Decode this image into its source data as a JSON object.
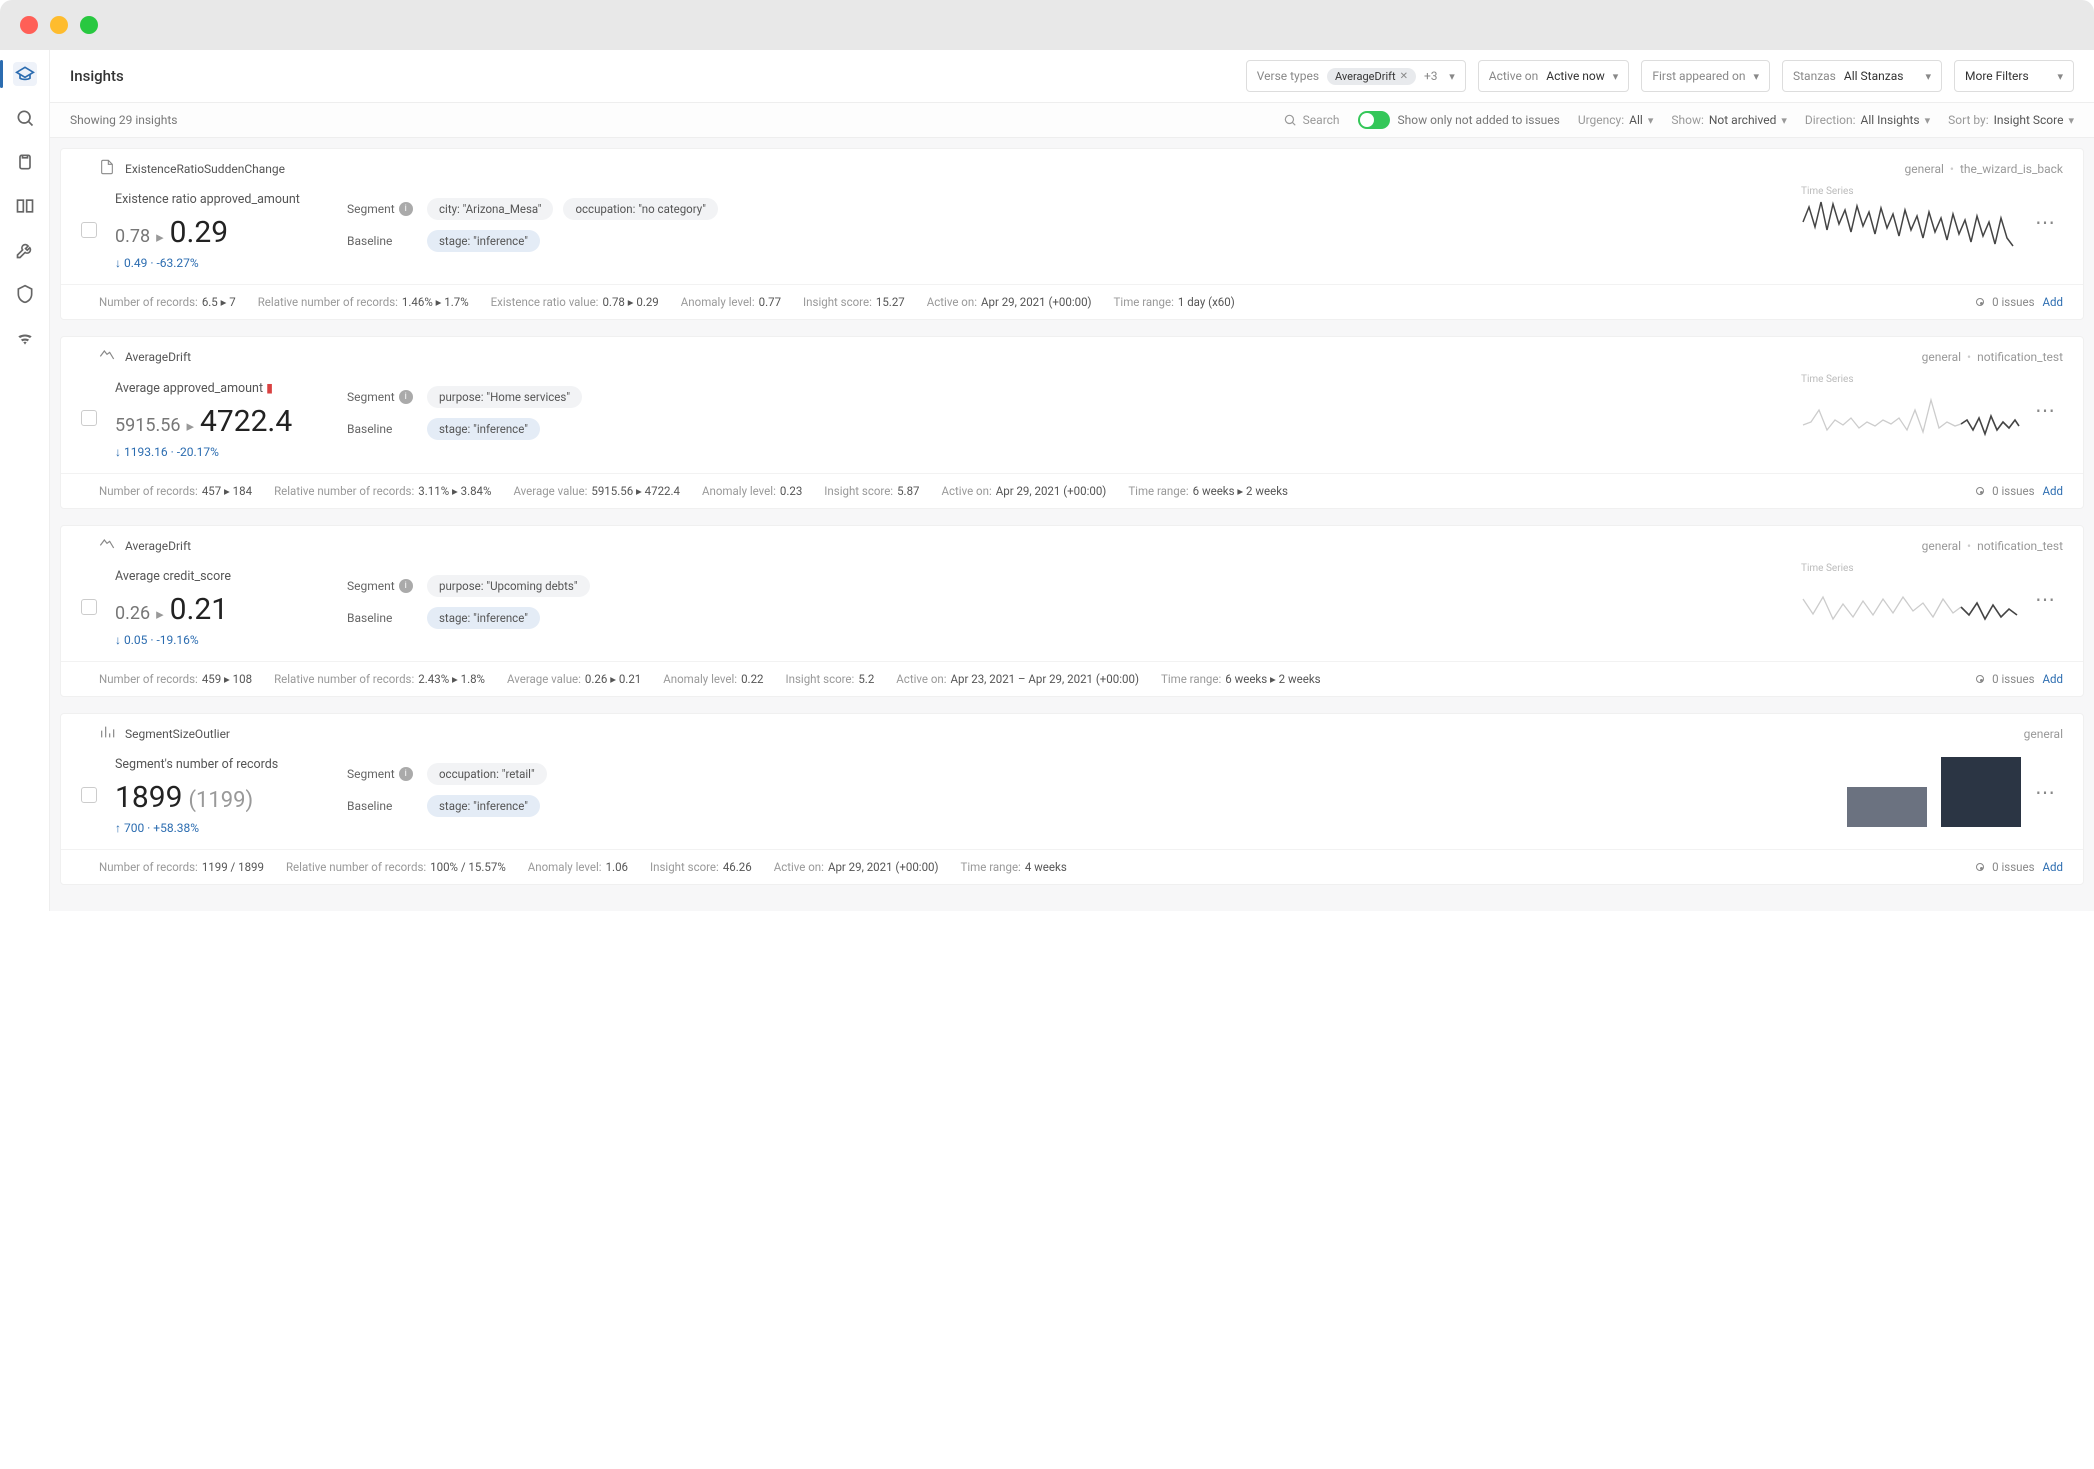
{
  "pageTitle": "Insights",
  "filters": {
    "verseTypes": {
      "label": "Verse types",
      "chip": "AverageDrift",
      "extra": "+3"
    },
    "activeOn": {
      "label": "Active on",
      "value": "Active now"
    },
    "firstAppeared": {
      "label": "First appeared on",
      "value": ""
    },
    "stanzas": {
      "label": "Stanzas",
      "value": "All Stanzas"
    },
    "more": {
      "label": "More Filters"
    }
  },
  "subbar": {
    "showing": "Showing 29 insights",
    "search": "Search",
    "toggleLabel": "Show only not added to issues",
    "urgency": {
      "label": "Urgency:",
      "value": "All"
    },
    "show": {
      "label": "Show:",
      "value": "Not archived"
    },
    "direction": {
      "label": "Direction:",
      "value": "All Insights"
    },
    "sortBy": {
      "label": "Sort by:",
      "value": "Insight Score"
    }
  },
  "labels": {
    "segment": "Segment",
    "baseline": "Baseline",
    "issuesText": "0 issues",
    "add": "Add",
    "timeSeries": "Time Series"
  },
  "statLabels": {
    "numRecords": "Number of records:",
    "relNumRecords": "Relative number of records:",
    "existenceRatio": "Existence ratio value:",
    "avgValue": "Average value:",
    "anomaly": "Anomaly level:",
    "insightScore": "Insight score:",
    "activeOn": "Active on:",
    "timeRange": "Time range:"
  },
  "cards": [
    {
      "type": "ExistenceRatioSuddenChange",
      "metaLeft": "general",
      "metaRight": "the_wizard_is_back",
      "metricTitle": "Existence ratio approved_amount",
      "before": "0.78",
      "after": "0.29",
      "ref": "",
      "delta": "↓ 0.49 · -63.27%",
      "deltaDir": "down",
      "segmentTags": [
        "city: \"Arizona_Mesa\"",
        "occupation: \"no category\""
      ],
      "baselineTags": [
        "stage: \"inference\""
      ],
      "stats": {
        "numRecords": "6.5 ▸ 7",
        "relNumRecords": "1.46% ▸ 1.7%",
        "valueLabel": "existenceRatio",
        "value": "0.78 ▸ 0.29",
        "anomaly": "0.77",
        "insightScore": "15.27",
        "activeOn": "Apr 29, 2021 (+00:00)",
        "timeRange": "1 day (x60)"
      },
      "chart": "spark1"
    },
    {
      "type": "AverageDrift",
      "metaLeft": "general",
      "metaRight": "notification_test",
      "metricTitle": "Average approved_amount",
      "flag": true,
      "before": "5915.56",
      "after": "4722.4",
      "ref": "",
      "delta": "↓ 1193.16 · -20.17%",
      "deltaDir": "down",
      "segmentTags": [
        "purpose: \"Home services\""
      ],
      "baselineTags": [
        "stage: \"inference\""
      ],
      "stats": {
        "numRecords": "457 ▸ 184",
        "relNumRecords": "3.11% ▸ 3.84%",
        "valueLabel": "avgValue",
        "value": "5915.56 ▸ 4722.4",
        "anomaly": "0.23",
        "insightScore": "5.87",
        "activeOn": "Apr 29, 2021 (+00:00)",
        "timeRange": "6 weeks ▸ 2 weeks"
      },
      "chart": "spark2"
    },
    {
      "type": "AverageDrift",
      "metaLeft": "general",
      "metaRight": "notification_test",
      "metricTitle": "Average credit_score",
      "before": "0.26",
      "after": "0.21",
      "ref": "",
      "delta": "↓ 0.05 · -19.16%",
      "deltaDir": "down",
      "segmentTags": [
        "purpose: \"Upcoming debts\""
      ],
      "baselineTags": [
        "stage: \"inference\""
      ],
      "stats": {
        "numRecords": "459 ▸ 108",
        "relNumRecords": "2.43% ▸ 1.8%",
        "valueLabel": "avgValue",
        "value": "0.26 ▸ 0.21",
        "anomaly": "0.22",
        "insightScore": "5.2",
        "activeOn": "Apr 23, 2021 – Apr 29, 2021 (+00:00)",
        "timeRange": "6 weeks ▸ 2 weeks"
      },
      "chart": "spark3"
    },
    {
      "type": "SegmentSizeOutlier",
      "metaLeft": "general",
      "metaRight": "",
      "metricTitle": "Segment's number of records",
      "before": "",
      "after": "1899",
      "ref": "(1199)",
      "delta": "↑ 700 · +58.38%",
      "deltaDir": "up",
      "segmentTags": [
        "occupation: \"retail\""
      ],
      "baselineTags": [
        "stage: \"inference\""
      ],
      "stats": {
        "numRecords": "1199 / 1899",
        "relNumRecords": "100% / 15.57%",
        "valueLabel": "",
        "value": "",
        "anomaly": "1.06",
        "insightScore": "46.26",
        "activeOn": "Apr 29, 2021 (+00:00)",
        "timeRange": "4 weeks"
      },
      "chart": "bars"
    }
  ]
}
